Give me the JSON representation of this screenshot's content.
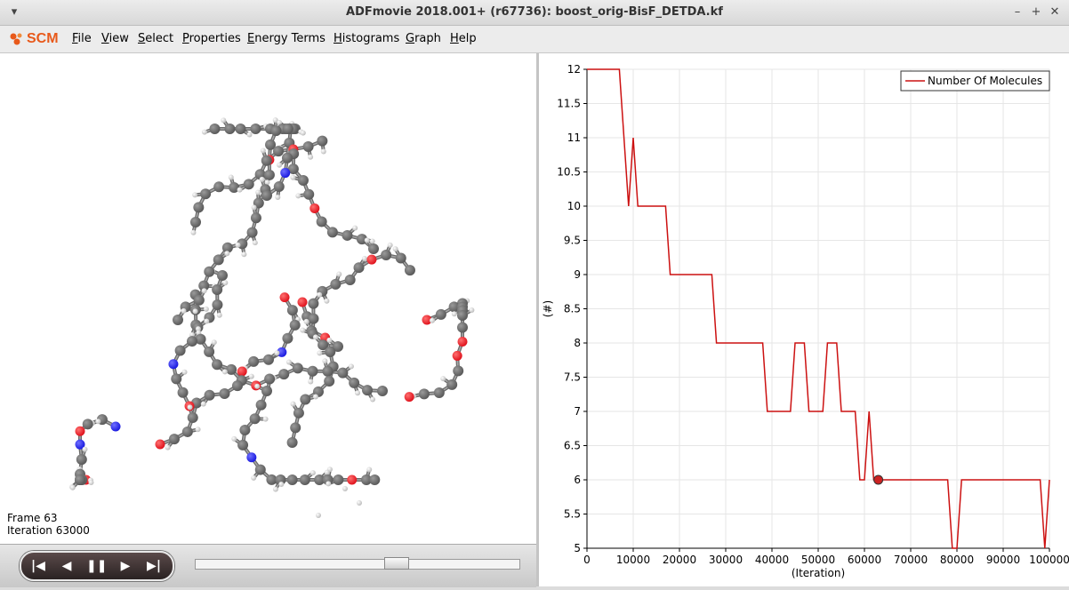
{
  "window": {
    "title": "ADFmovie 2018.001+ (r67736): boost_orig-BisF_DETDA.kf",
    "menu_icon": "chevron-down-icon",
    "minimize_icon": "minimize-icon",
    "maximize_icon": "maximize-icon",
    "close_icon": "close-icon"
  },
  "menubar": {
    "logo_text": "SCM",
    "logo_color": "#e8591a",
    "items": [
      {
        "ul": "F",
        "rest": "ile"
      },
      {
        "ul": "V",
        "rest": "iew"
      },
      {
        "ul": "S",
        "rest": "elect"
      },
      {
        "ul": "P",
        "rest": "roperties"
      },
      {
        "ul": "E",
        "rest": "nergy Terms"
      },
      {
        "ul": "H",
        "rest": "istograms"
      },
      {
        "ul": "G",
        "rest": "raph"
      },
      {
        "ul": "H",
        "rest": "elp"
      }
    ]
  },
  "viewer": {
    "frame_text": "Frame 63",
    "iteration_text": "Iteration 63000",
    "atom_colors": {
      "carbon": "#5a5a5a",
      "oxygen": "#e0141e",
      "nitrogen": "#1c1ce0",
      "hydrogen": "#eeeeee"
    }
  },
  "playback": {
    "first_icon": "skip-first-icon",
    "prev_icon": "step-back-icon",
    "pause_icon": "pause-icon",
    "next_icon": "step-forward-icon",
    "last_icon": "skip-last-icon",
    "position": 0.63
  },
  "chart_data": {
    "type": "line",
    "title": "",
    "xlabel": "(Iteration)",
    "ylabel": "(#)",
    "xlim": [
      0,
      100000
    ],
    "ylim": [
      5,
      12
    ],
    "x_ticks": [
      "0",
      "10000",
      "20000",
      "30000",
      "40000",
      "50000",
      "60000",
      "70000",
      "80000",
      "90000",
      "100000"
    ],
    "y_ticks": [
      "5",
      "5.5",
      "6",
      "6.5",
      "7",
      "7.5",
      "8",
      "8.5",
      "9",
      "9.5",
      "10",
      "10.5",
      "11",
      "11.5",
      "12"
    ],
    "grid": true,
    "legend_position": "top-right",
    "series": [
      {
        "name": "Number Of Molecules",
        "color": "#cc1111",
        "x": [
          0,
          7000,
          9000,
          10000,
          11000,
          17000,
          18000,
          27000,
          28000,
          38000,
          39000,
          44000,
          45000,
          47000,
          48000,
          51000,
          52000,
          54000,
          55000,
          58000,
          59000,
          60000,
          61000,
          62000,
          63000,
          78000,
          79000,
          80000,
          81000,
          97000,
          98000,
          99000,
          100000
        ],
        "y": [
          12,
          12,
          10,
          11,
          10,
          10,
          9,
          9,
          8,
          8,
          7,
          7,
          8,
          8,
          7,
          7,
          8,
          8,
          7,
          7,
          6,
          6,
          7,
          6,
          6,
          6,
          5,
          5,
          6,
          6,
          6,
          5,
          6
        ]
      }
    ],
    "marker": {
      "x": 63000,
      "y": 6
    }
  }
}
